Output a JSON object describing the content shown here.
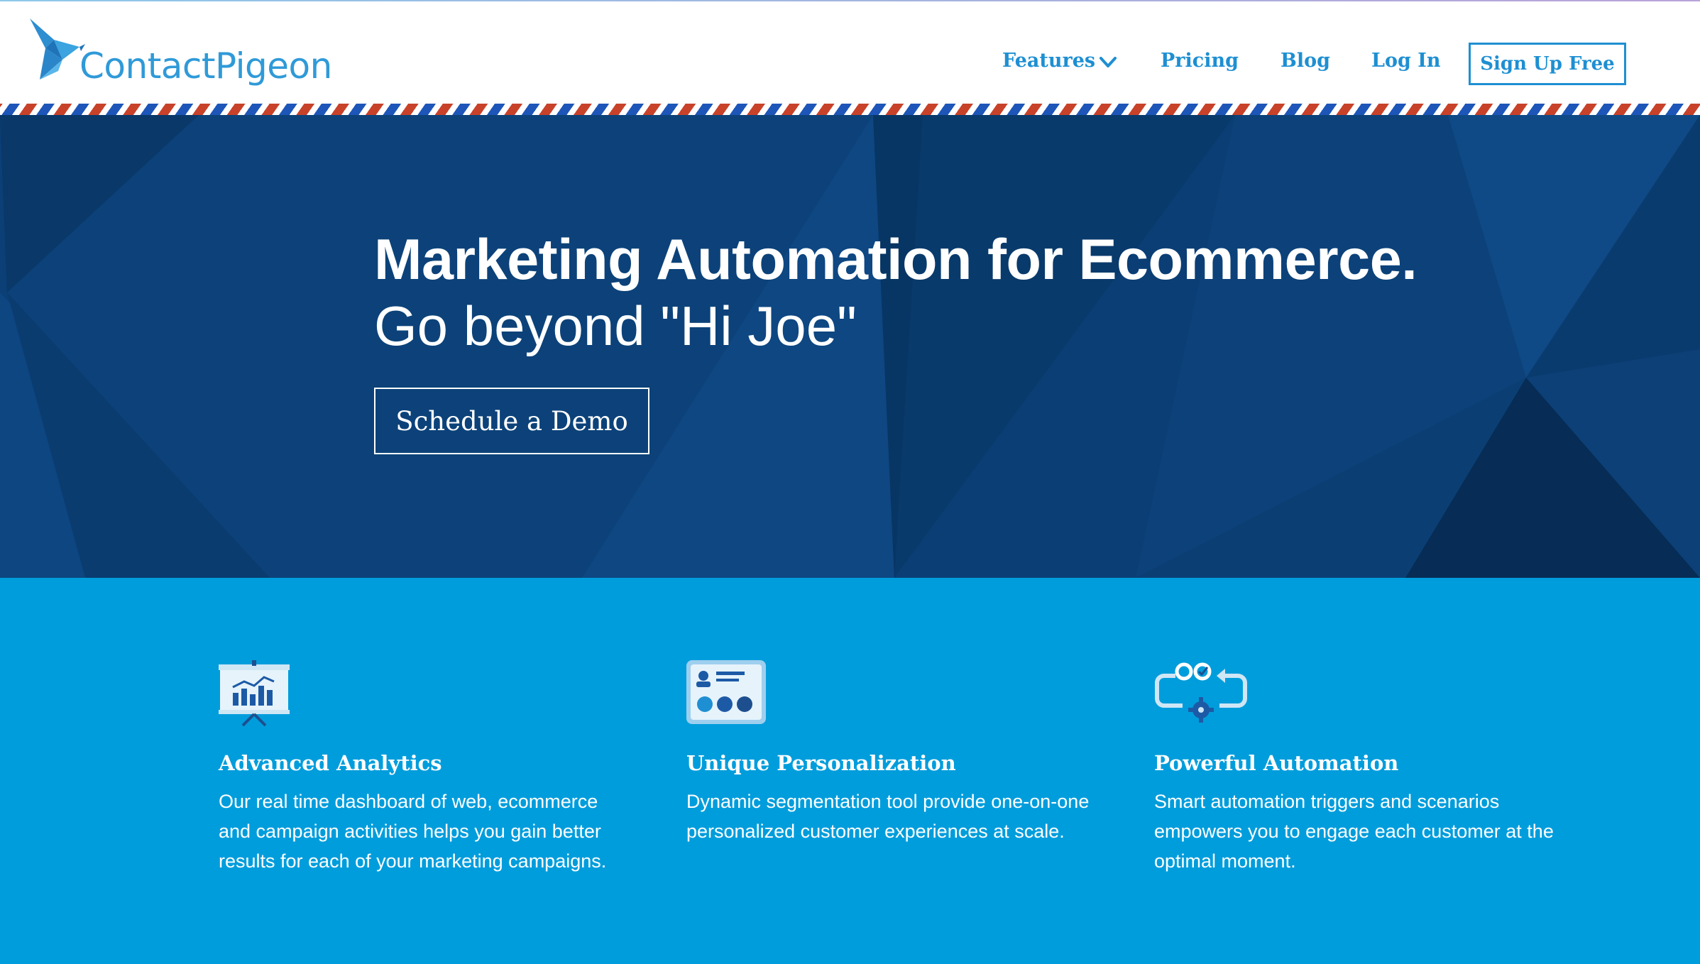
{
  "header": {
    "logo_text": "ContactPigeon",
    "nav": {
      "features_label": "Features",
      "pricing_label": "Pricing",
      "blog_label": "Blog",
      "login_label": "Log In",
      "signup_label": "Sign Up Free"
    }
  },
  "hero": {
    "title": "Marketing Automation for Ecommerce.",
    "subtitle": "Go beyond \"Hi Joe\"",
    "cta_label": "Schedule a Demo"
  },
  "features": [
    {
      "icon": "analytics-board-icon",
      "title": "Advanced Analytics",
      "description": "Our real time dashboard of web, ecommerce and campaign activities helps you gain better results for each of your marketing campaigns."
    },
    {
      "icon": "profile-card-icon",
      "title": "Unique Personalization",
      "description": "Dynamic segmentation tool provide one-on-one personalized customer experiences at scale."
    },
    {
      "icon": "automation-cycle-icon",
      "title": "Powerful Automation",
      "description": "Smart automation triggers and scenarios empowers you to engage each customer at the optimal moment."
    }
  ],
  "colors": {
    "brand_blue": "#1e8fd2",
    "hero_navy": "#0a3d72",
    "features_blue": "#009ddc",
    "airmail_red": "#c8422a",
    "airmail_blue": "#1d56b8"
  }
}
